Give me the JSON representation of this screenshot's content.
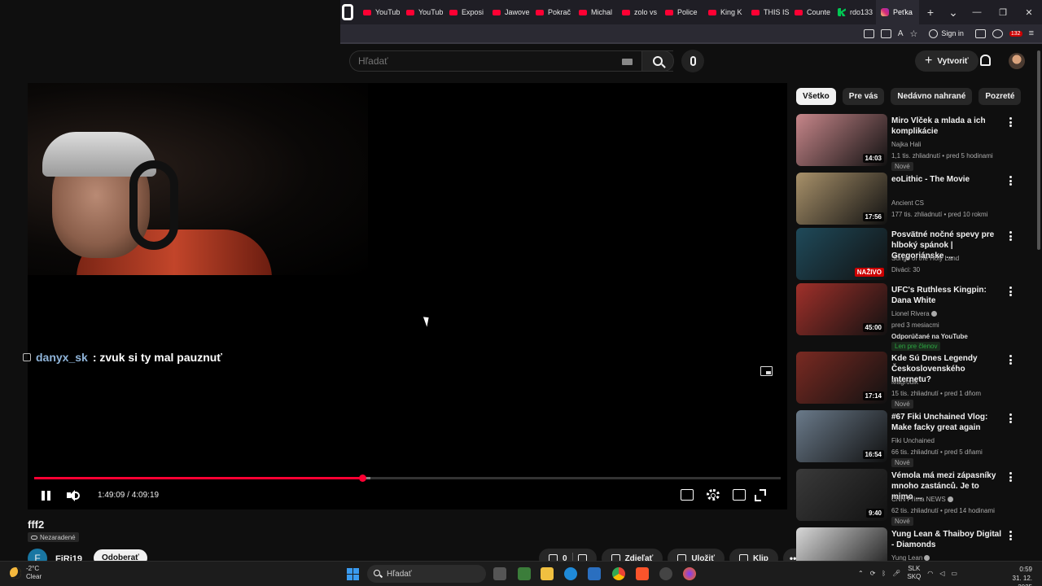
{
  "browser": {
    "tabs": [
      {
        "label": "YouTub",
        "favicon": "youtube-icon"
      },
      {
        "label": "YouTub",
        "favicon": "youtube-icon"
      },
      {
        "label": "Exposi",
        "favicon": "youtube-icon"
      },
      {
        "label": "Jawove",
        "favicon": "youtube-icon"
      },
      {
        "label": "Pokrač",
        "favicon": "youtube-icon"
      },
      {
        "label": "Michal",
        "favicon": "youtube-icon"
      },
      {
        "label": "zolo vs",
        "favicon": "youtube-icon"
      },
      {
        "label": "Police",
        "favicon": "youtube-icon"
      },
      {
        "label": "King K",
        "favicon": "youtube-icon"
      },
      {
        "label": "THIS IS",
        "favicon": "youtube-icon"
      },
      {
        "label": "Counte",
        "favicon": "youtube-icon"
      },
      {
        "label": "rdo133",
        "favicon": "kick-icon"
      },
      {
        "label": "Peťka",
        "favicon": "instagram-icon"
      }
    ],
    "signin_label": "Sign in",
    "extension_badge": "132"
  },
  "youtube": {
    "search_placeholder": "Hľadať",
    "create_label": "Vytvoriť"
  },
  "player": {
    "chat_user": "danyx_sk",
    "chat_text": ": zvuk si ty mal pauznuť",
    "time_current": "1:49:09",
    "time_separator": "/",
    "time_total": "4:09:19",
    "progress_played_fraction": 0.44,
    "progress_loaded_fraction": 0.45
  },
  "video": {
    "title": "fff2",
    "category": "Nezaradené",
    "channel_initial": "F",
    "channel_name": "FiRi19",
    "subscribe_label": "Odoberať",
    "likes": "0",
    "share_label": "Zdieľať",
    "save_label": "Uložiť",
    "clip_label": "Klip"
  },
  "chips": [
    "Všetko",
    "Pre vás",
    "Nedávno nahrané",
    "Pozreté"
  ],
  "recommendations": [
    {
      "title": "Miro Vlček a mlada a ich komplikácie",
      "channel": "Najka Hali",
      "meta": "1,1 tis. zhliadnutí • pred 5 hodinami",
      "duration": "14:03",
      "badge": "Nové",
      "thumb_color": "#c7868a"
    },
    {
      "title": "eoLithic - The Movie",
      "channel": "Ancient CS",
      "meta": "177 tis. zhliadnutí • pred 10 rokmi",
      "duration": "17:56",
      "badge": "",
      "thumb_color": "#a8916a"
    },
    {
      "title": "Posvätné nočné spevy pre hlboký spánok | Gregoriánske ...",
      "channel": "Songs of the Holy Land",
      "meta": "Diváci: 30",
      "duration": "NAŽIVO",
      "badge": "",
      "thumb_color": "#1f4a5a"
    },
    {
      "title": "UFC's Ruthless Kingpin: Dana White",
      "channel": "Lionel Rivera",
      "meta": "pred 3 mesiacmi",
      "extra": "Odporúčané na YouTube",
      "duration": "45:00",
      "badge": "Len pre členov",
      "thumb_color": "#a0302a"
    },
    {
      "title": "Kde Sú Dnes Legendy Československého Internetu?",
      "channel": "Magrodik",
      "meta": "15 tis. zhliadnutí • pred 1 dňom",
      "duration": "17:14",
      "badge": "Nové",
      "thumb_color": "#7a2a22"
    },
    {
      "title": "#67 Fiki Unchained Vlog: Make facky great again",
      "channel": "Fiki Unchained",
      "meta": "66 tis. zhliadnutí • pred 5 dňami",
      "duration": "16:54",
      "badge": "Nové",
      "thumb_color": "#6a7a8a"
    },
    {
      "title": "Vémola má mezi zápasníky mnoho zastánců. Je to mimo ...",
      "channel": "CNN Prima NEWS",
      "meta": "62 tis. zhliadnutí • pred 14 hodinami",
      "duration": "9:40",
      "badge": "Nové",
      "thumb_color": "#3a3a3a"
    },
    {
      "title": "Yung Lean & Thaiboy Digital - Diamonds",
      "channel": "Yung Lean",
      "meta": "",
      "duration": "",
      "badge": "",
      "thumb_color": "#d8d8d8"
    }
  ],
  "taskbar": {
    "temperature": "-2°C",
    "weather_text": "Clear",
    "search_placeholder": "Hľadať",
    "lang_1": "SLK",
    "lang_2": "SKQ",
    "time": "0:59",
    "date": "31. 12. 2025"
  }
}
